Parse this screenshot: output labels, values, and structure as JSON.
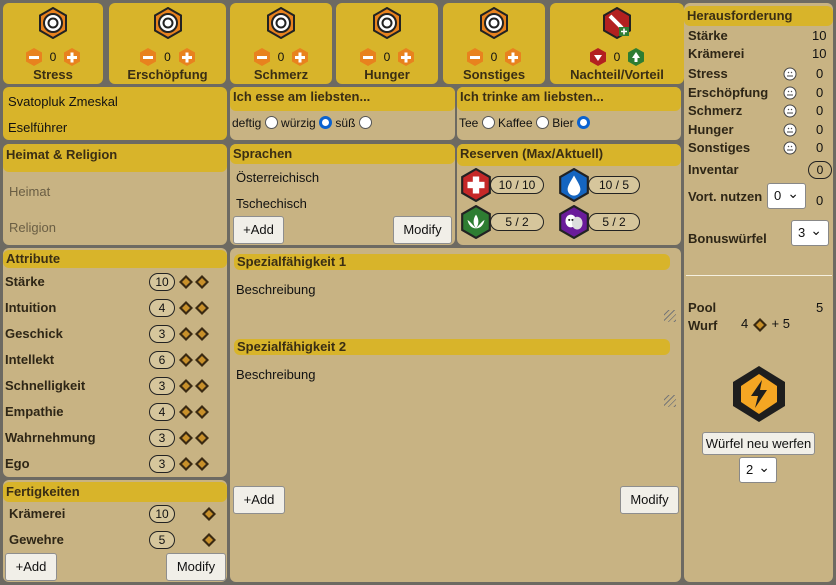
{
  "conditions": [
    {
      "label": "Stress",
      "value": "0"
    },
    {
      "label": "Erschöpfung",
      "value": "0"
    },
    {
      "label": "Schmerz",
      "value": "0"
    },
    {
      "label": "Hunger",
      "value": "0"
    },
    {
      "label": "Sonstiges",
      "value": "0"
    },
    {
      "label": "Nachteil/Vorteil",
      "value": "0"
    }
  ],
  "character": {
    "name": "Svatopluk Zmeskal",
    "role": "Eselführer"
  },
  "food": {
    "title": "Ich esse am liebsten...",
    "options": [
      "deftig",
      "würzig",
      "süß"
    ],
    "selected": "süß"
  },
  "drink": {
    "title": "Ich trinke am liebsten...",
    "options": [
      "Tee",
      "Kaffee",
      "Bier"
    ],
    "selected": "Bier"
  },
  "home": {
    "title": "Heimat & Religion",
    "heimat_placeholder": "Heimat",
    "religion_placeholder": "Religion"
  },
  "languages": {
    "title": "Sprachen",
    "items": [
      "Österreichisch",
      "Tschechisch"
    ],
    "add": "+Add",
    "modify": "Modify"
  },
  "reserves": {
    "title": "Reserven (Max/Aktuell)",
    "health": "10 / 10",
    "water": "10 / 5",
    "lotus": "5 / 2",
    "mask": "5 / 2"
  },
  "attributes": {
    "title": "Attribute",
    "items": [
      {
        "label": "Stärke",
        "value": "10"
      },
      {
        "label": "Intuition",
        "value": "4"
      },
      {
        "label": "Geschick",
        "value": "3"
      },
      {
        "label": "Intellekt",
        "value": "6"
      },
      {
        "label": "Schnelligkeit",
        "value": "3"
      },
      {
        "label": "Empathie",
        "value": "4"
      },
      {
        "label": "Wahrnehmung",
        "value": "3"
      },
      {
        "label": "Ego",
        "value": "3"
      }
    ]
  },
  "skills": {
    "title": "Fertigkeiten",
    "items": [
      {
        "label": "Krämerei",
        "value": "10"
      },
      {
        "label": "Gewehre",
        "value": "5"
      }
    ],
    "add": "+Add",
    "modify": "Modify"
  },
  "special": {
    "items": [
      {
        "title": "Spezialfähigkeit 1",
        "desc": "Beschreibung"
      },
      {
        "title": "Spezialfähigkeit 2",
        "desc": "Beschreibung"
      }
    ],
    "add": "+Add",
    "modify": "Modify"
  },
  "challenge": {
    "title": "Herausforderung",
    "base": [
      {
        "label": "Stärke",
        "value": "10"
      },
      {
        "label": "Krämerei",
        "value": "10"
      }
    ],
    "stats": [
      {
        "label": "Stress",
        "value": "0"
      },
      {
        "label": "Erschöpfung",
        "value": "0"
      },
      {
        "label": "Schmerz",
        "value": "0"
      },
      {
        "label": "Hunger",
        "value": "0"
      },
      {
        "label": "Sonstiges",
        "value": "0"
      }
    ],
    "inventar_label": "Inventar",
    "inventar_value": "0",
    "vort_label": "Vort. nutzen",
    "vort_select": "0",
    "vort_value": "0",
    "bonus_label": "Bonuswürfel",
    "bonus_select": "3",
    "pool_label": "Pool",
    "pool_value": "5",
    "wurf_label": "Wurf",
    "wurf_count": "4",
    "wurf_bonus": "+ 5",
    "reroll_button": "Würfel neu werfen",
    "reroll_select": "2"
  },
  "colors": {
    "accent": "#d8b42a",
    "panel": "#c8b383",
    "background": "#6d6a62",
    "orange": "#e8821e"
  }
}
